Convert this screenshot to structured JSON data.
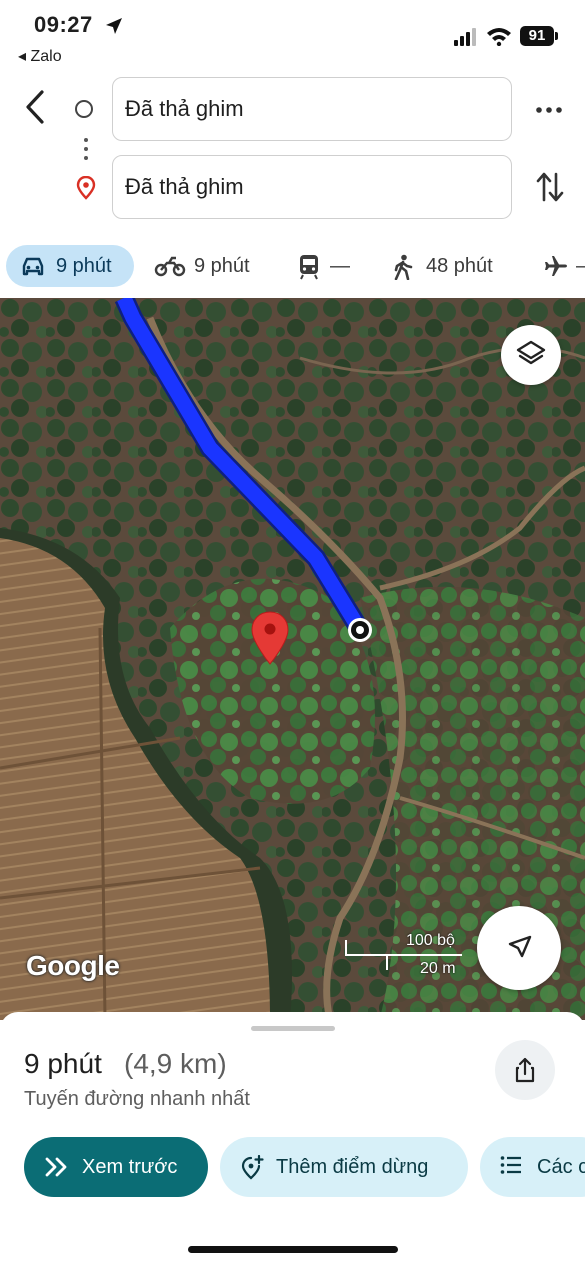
{
  "status_bar": {
    "time": "09:27",
    "back_app": "◂ Zalo",
    "battery": "91"
  },
  "header": {
    "origin": "Đã thả ghim",
    "destination": "Đã thả ghim"
  },
  "modes": [
    {
      "icon": "car-icon",
      "label": "9 phút",
      "selected": true
    },
    {
      "icon": "motorbike-icon",
      "label": "9 phút"
    },
    {
      "icon": "transit-icon",
      "label": "—"
    },
    {
      "icon": "walk-icon",
      "label": "48 phút"
    },
    {
      "icon": "flight-icon",
      "label": "–"
    }
  ],
  "map": {
    "logo": "Google",
    "scale_imperial": "100 bộ",
    "scale_metric": "20 m",
    "route_color": "#1a35ff",
    "pin_color": "#e53935"
  },
  "sheet": {
    "duration": "9 phút",
    "distance": "(4,9 km)",
    "description": "Tuyến đường nhanh nhất",
    "preview_label": "Xem trước",
    "add_stop_label": "Thêm điểm dừng",
    "steps_label": "Các c"
  },
  "colors": {
    "accent": "#0b6d75",
    "chip": "#d7f0f8",
    "mode_selected": "#c5e3f7"
  }
}
